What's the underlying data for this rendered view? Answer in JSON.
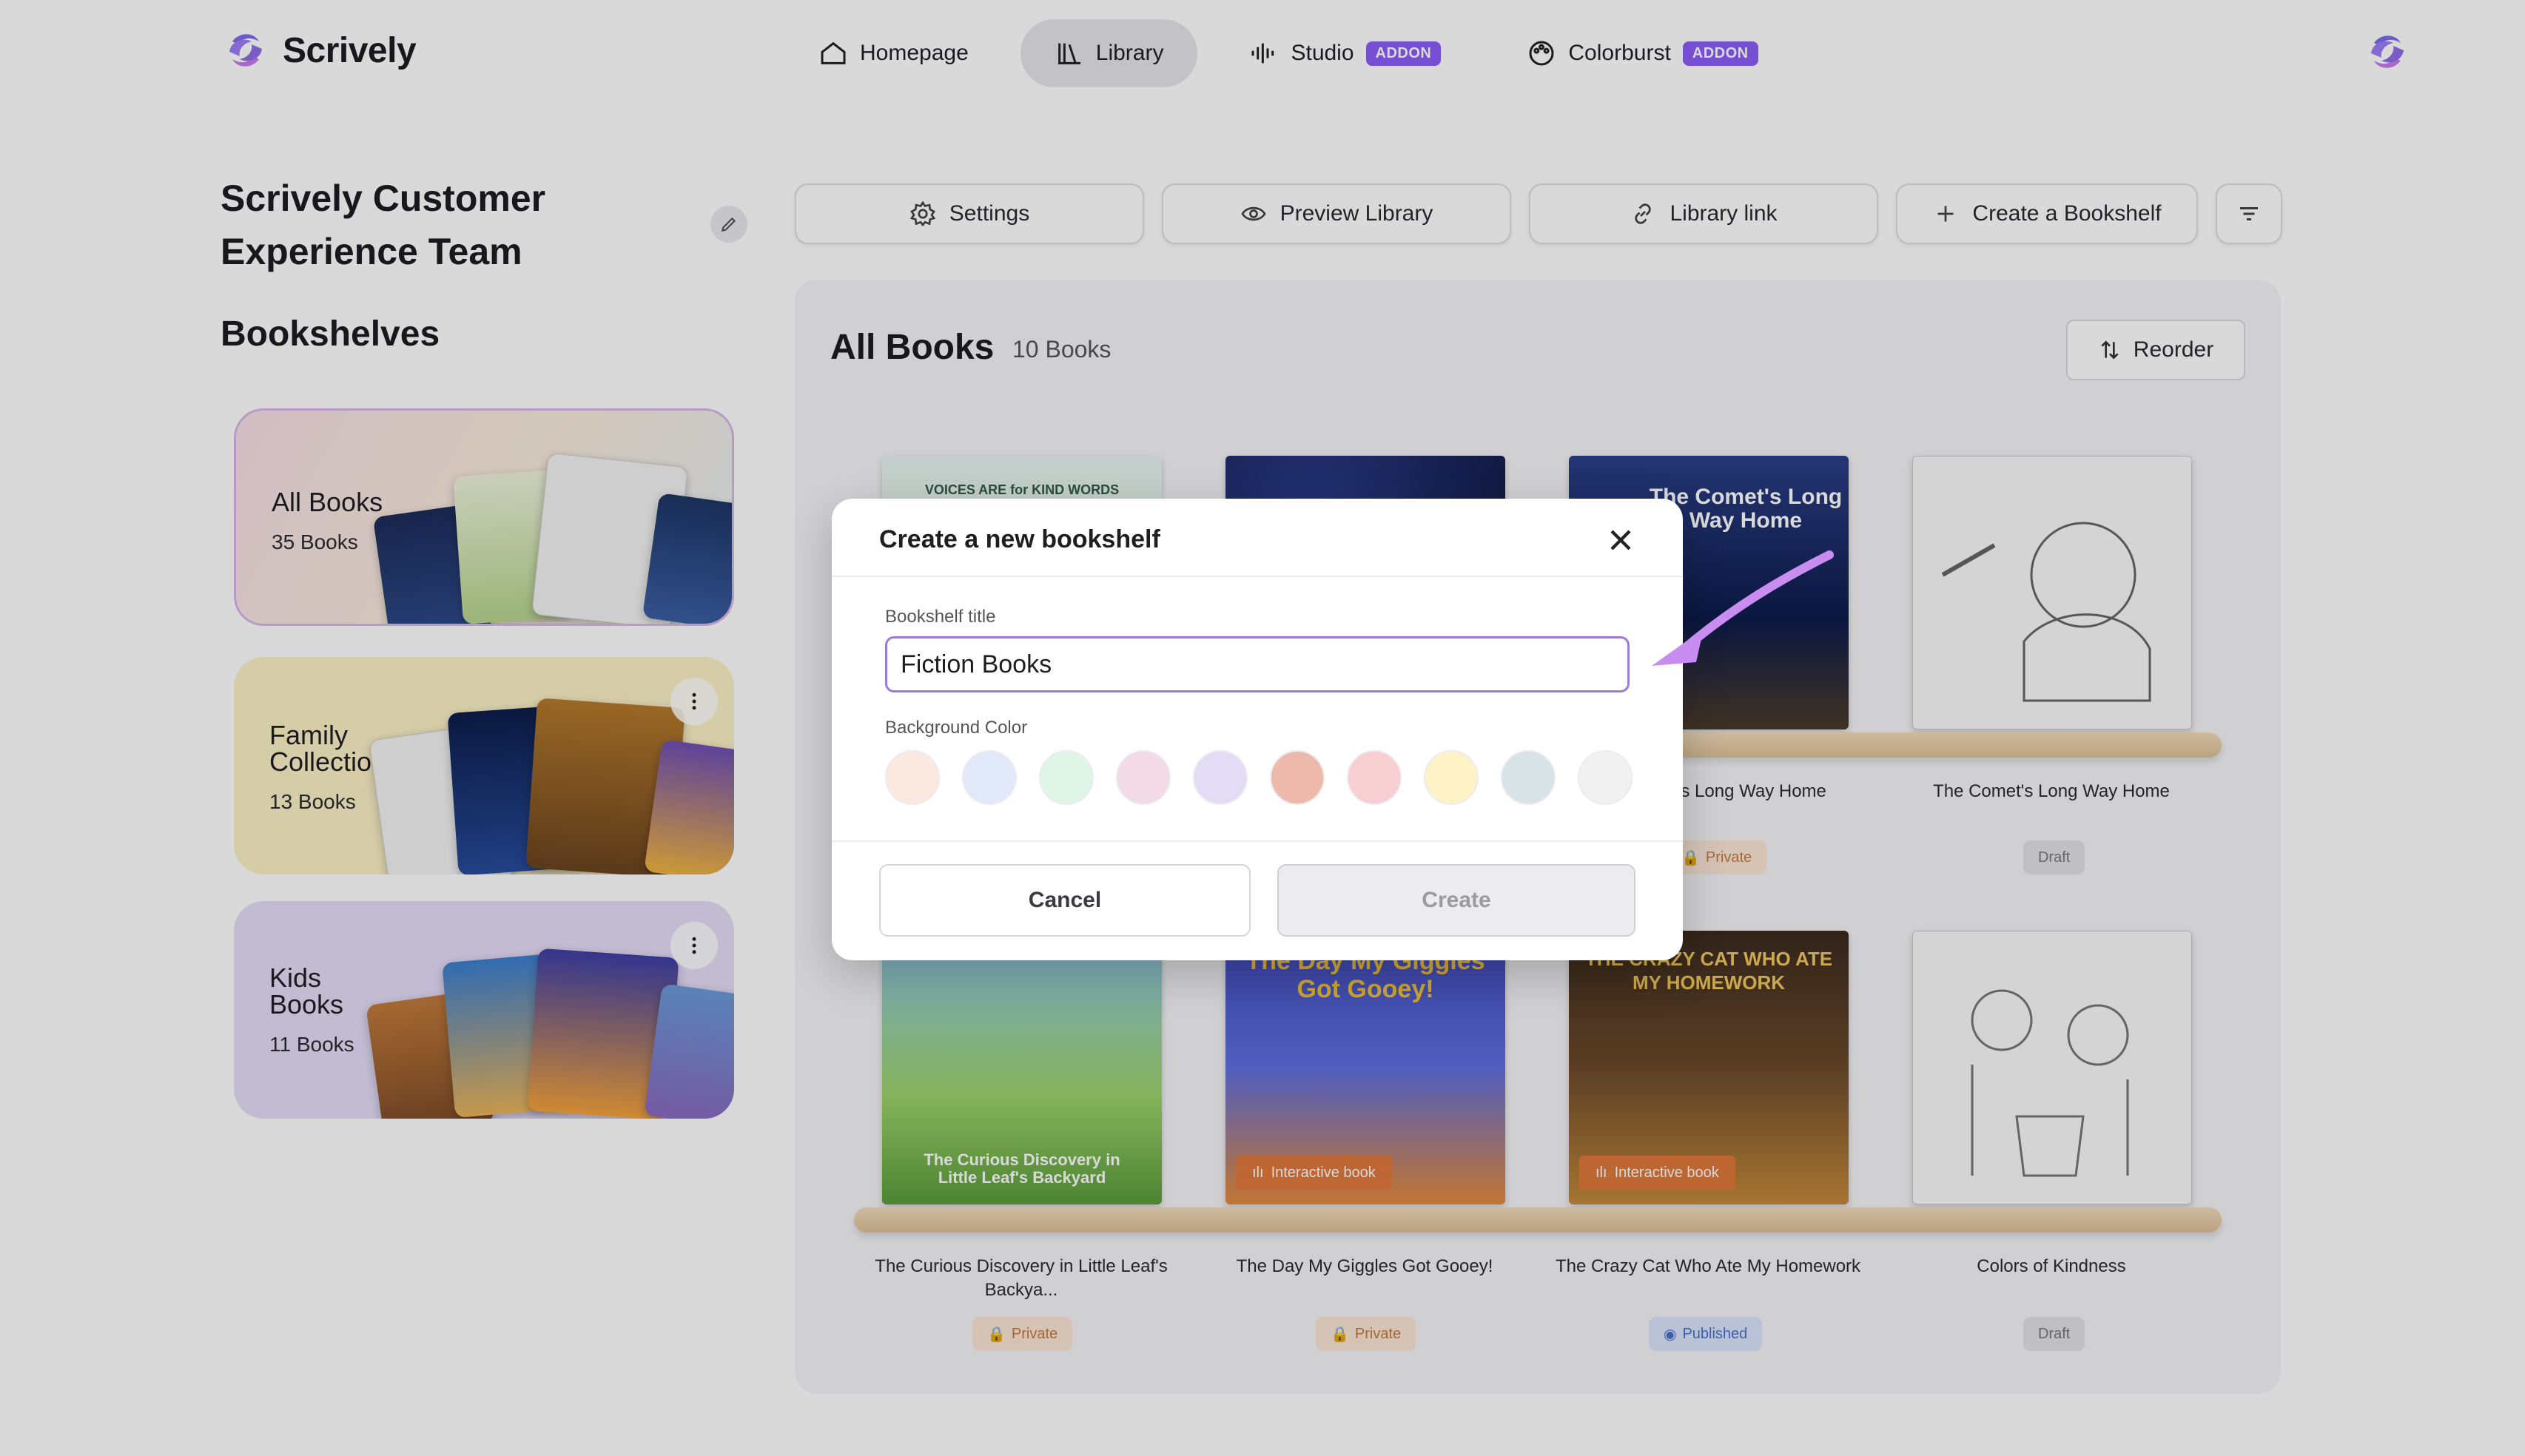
{
  "app": {
    "name": "Scrively"
  },
  "nav": {
    "items": [
      {
        "label": "Homepage",
        "icon": "home-icon",
        "active": false
      },
      {
        "label": "Library",
        "icon": "library-icon",
        "active": true
      },
      {
        "label": "Studio",
        "icon": "waveform-icon",
        "badge": "ADDON"
      },
      {
        "label": "Colorburst",
        "icon": "palette-icon",
        "badge": "ADDON"
      }
    ]
  },
  "sidebar": {
    "team_name": "Scrively Customer Experience Team",
    "section_title": "Bookshelves",
    "shelves": [
      {
        "title": "All Books",
        "count": "35 Books"
      },
      {
        "title": "Family Collection",
        "count": "13 Books"
      },
      {
        "title": "Kids Books",
        "count": "11 Books"
      }
    ]
  },
  "toolbar": {
    "settings": "Settings",
    "preview": "Preview Library",
    "link": "Library link",
    "create": "Create a Bookshelf"
  },
  "main": {
    "title": "All Books",
    "count": "10 Books",
    "reorder": "Reorder",
    "books": [
      {
        "title": "Voices Are for Kind Words",
        "cover_text": "VOICES ARE for KIND WORDS"
      },
      {
        "title": "",
        "cover_text": ""
      },
      {
        "title": "The Comet's Long Way Home",
        "cover_text": "The Comet's Long Way Home",
        "badge": "Private"
      },
      {
        "title": "The Comet's Long Way Home",
        "badge": "Draft"
      },
      {
        "title": "The Curious Discovery in Little Leaf's Backya...",
        "cover_text": "The Curious Discovery in Little Leaf's Backyard",
        "badge": "Private"
      },
      {
        "title": "The Day My Giggles Got Gooey!",
        "cover_text": "The Day My Giggles Got Gooey!",
        "badge": "Private",
        "tag": "Interactive book"
      },
      {
        "title": "The Crazy Cat Who Ate My Homework",
        "cover_text": "THE CRAZY CAT WHO ATE MY HOMEWORK",
        "badge": "Published",
        "tag": "Interactive book"
      },
      {
        "title": "Colors of Kindness",
        "badge": "Draft"
      }
    ]
  },
  "modal": {
    "title": "Create a new bookshelf",
    "field_label": "Bookshelf title",
    "field_value": "Fiction Books",
    "color_label": "Background Color",
    "colors": [
      "#fbe9e0",
      "#e2e9fb",
      "#dff5e6",
      "#f2dbe6",
      "#e4dcf5",
      "#ecb9ab",
      "#f7cfd3",
      "#fdf1c6",
      "#d8e3e8",
      "#f1f1f2"
    ],
    "cancel": "Cancel",
    "create": "Create"
  }
}
